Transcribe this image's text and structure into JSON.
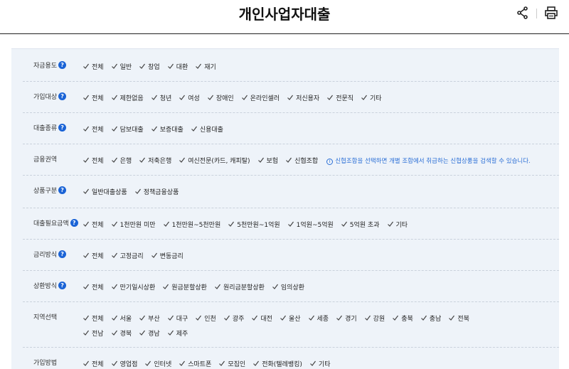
{
  "header": {
    "title": "개인사업자대출",
    "share_icon": "share-icon",
    "print_icon": "print-icon"
  },
  "accent": "#1a63d6",
  "rows": [
    {
      "label": "자금용도",
      "help": true,
      "options": [
        "전체",
        "일반",
        "창업",
        "대환",
        "재기"
      ]
    },
    {
      "label": "가입대상",
      "help": true,
      "options": [
        "전체",
        "제한없음",
        "청년",
        "여성",
        "장애인",
        "온라인셀러",
        "저신용자",
        "전문직",
        "기타"
      ]
    },
    {
      "label": "대출종류",
      "help": true,
      "options": [
        "전체",
        "담보대출",
        "보증대출",
        "신용대출"
      ]
    },
    {
      "label": "금융권역",
      "help": false,
      "options": [
        "전체",
        "은행",
        "저축은행",
        "여신전문(카드, 캐피탈)",
        "보험",
        "신협조합"
      ],
      "note": "신협조합을 선택하면 개별 조합에서 취급하는 신협상품을 검색할 수 있습니다."
    },
    {
      "label": "상품구분",
      "help": true,
      "options": [
        "일반대출상품",
        "정책금융상품"
      ]
    },
    {
      "label": "대출필요금액",
      "help": true,
      "options": [
        "전체",
        "1천만원 미만",
        "1천만원~5천만원",
        "5천만원~1억원",
        "1억원~5억원",
        "5억원 초과",
        "기타"
      ]
    },
    {
      "label": "금리방식",
      "help": true,
      "options": [
        "전체",
        "고정금리",
        "변동금리"
      ]
    },
    {
      "label": "상환방식",
      "help": true,
      "options": [
        "전체",
        "만기일시상환",
        "원금분할상환",
        "원리금분할상환",
        "임의상환"
      ]
    },
    {
      "label": "지역선택",
      "help": false,
      "options": [
        "전체",
        "서울",
        "부산",
        "대구",
        "인천",
        "광주",
        "대전",
        "울산",
        "세종",
        "경기",
        "강원",
        "충북",
        "충남",
        "전북"
      ],
      "options2": [
        "전남",
        "경북",
        "경남",
        "제주"
      ]
    },
    {
      "label": "가입방법",
      "help": false,
      "options": [
        "전체",
        "영업점",
        "인터넷",
        "스마트폰",
        "모집인",
        "전화(텔레뱅킹)",
        "기타"
      ]
    }
  ]
}
